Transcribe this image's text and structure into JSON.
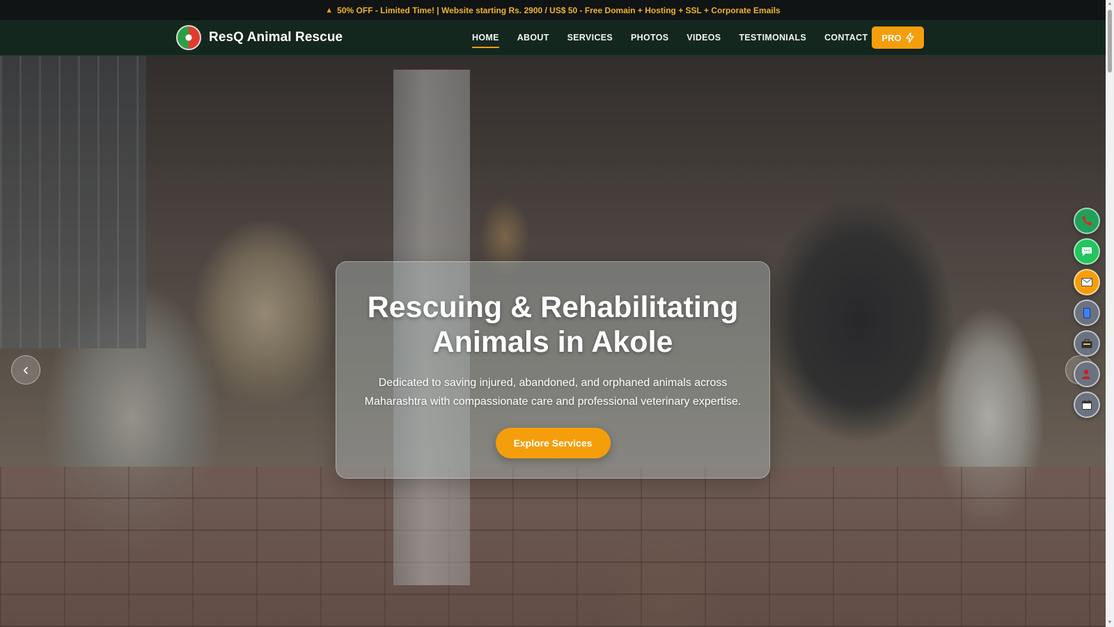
{
  "promo": {
    "icon": "fire-icon",
    "text": "50% OFF - Limited Time! | Website starting Rs. 2900 / US$ 50 - Free Domain + Hosting + SSL + Corporate Emails"
  },
  "header": {
    "brand_name": "ResQ Animal Rescue",
    "nav": [
      "HOME",
      "ABOUT",
      "SERVICES",
      "PHOTOS",
      "VIDEOS",
      "TESTIMONIALS",
      "CONTACT"
    ],
    "active_nav": "HOME",
    "pro_label": "PRO"
  },
  "hero": {
    "title_line1": "Rescuing & Rehabilitating",
    "title_line2": "Animals in Akole",
    "subtitle_line1": "Dedicated to saving injured, abandoned, and orphaned animals across",
    "subtitle_line2": "Maharashtra with compassionate care and professional veterinary expertise.",
    "cta_label": "Explore Services",
    "prev_glyph": "‹"
  },
  "floating_actions": [
    {
      "name": "phone-icon",
      "glyph": "📞",
      "color": "#22a05a"
    },
    {
      "name": "chat-icon",
      "glyph": "💬",
      "color": "#22c55e"
    },
    {
      "name": "email-icon",
      "glyph": "✉",
      "color": "#f59e0b"
    },
    {
      "name": "mobile-icon",
      "glyph": "▯",
      "color": "#6b7280"
    },
    {
      "name": "briefcase-icon",
      "glyph": "▣",
      "color": "#6b7280"
    },
    {
      "name": "user-icon",
      "glyph": "●",
      "color": "#6b7280"
    },
    {
      "name": "calendar-icon",
      "glyph": "▦",
      "color": "#6b7280"
    }
  ],
  "colors": {
    "accent": "#f59e0b",
    "nav_bg": "#14271f",
    "promo_text": "#f0b429"
  }
}
